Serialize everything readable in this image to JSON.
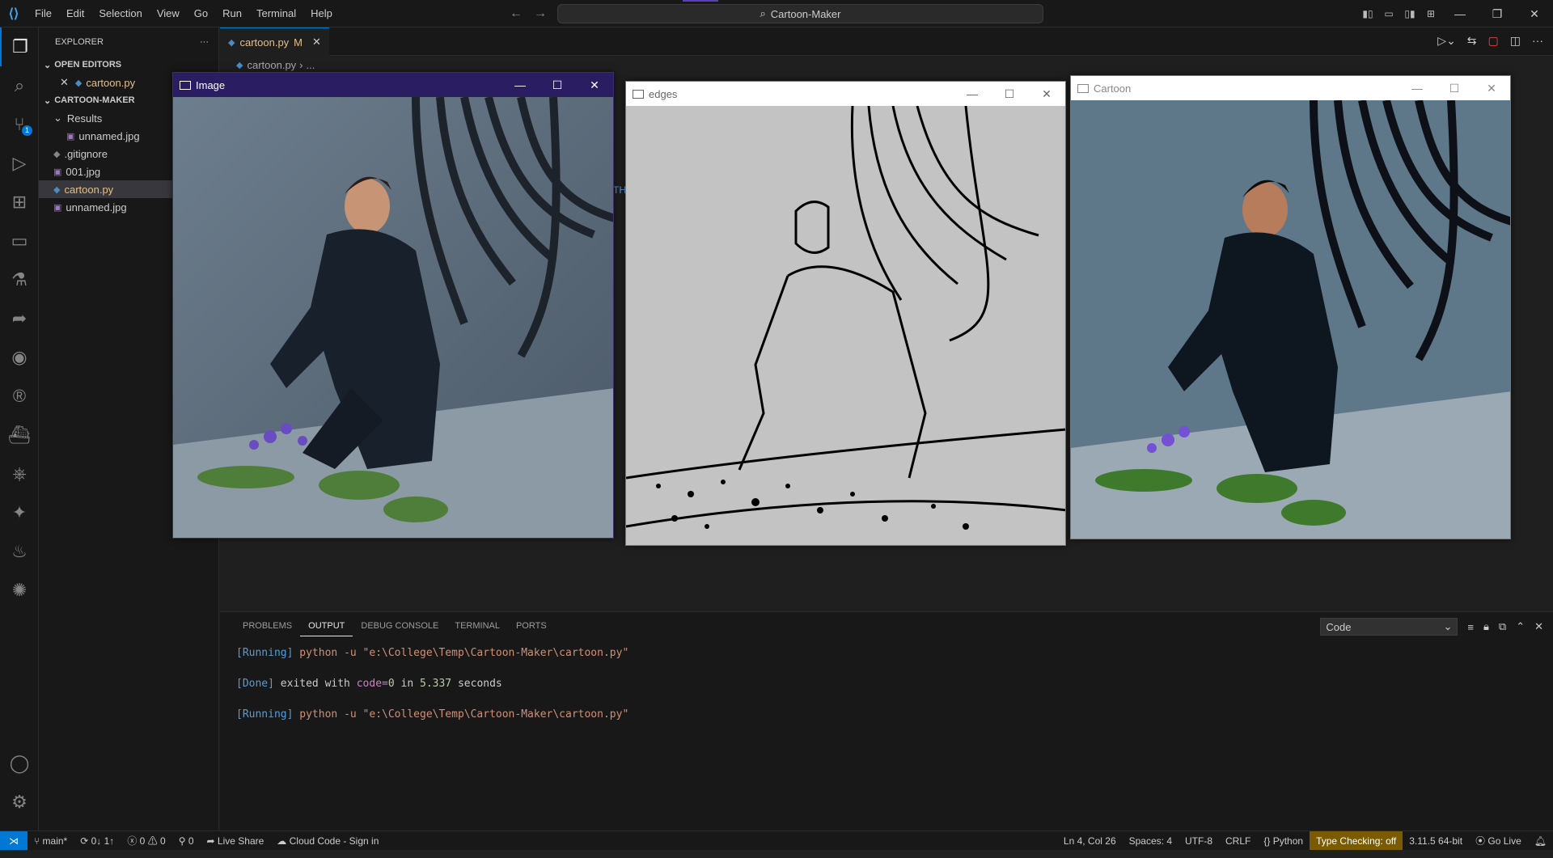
{
  "titlebar": {
    "menu": [
      "File",
      "Edit",
      "Selection",
      "View",
      "Go",
      "Run",
      "Terminal",
      "Help"
    ],
    "search": "Cartoon-Maker"
  },
  "activity": {
    "scm_badge": "1"
  },
  "sidebar": {
    "title": "EXPLORER",
    "more": "···",
    "open_editors_label": "OPEN EDITORS",
    "open_editors": [
      {
        "name": "cartoon.py"
      }
    ],
    "project_label": "CARTOON-MAKER",
    "folder": "Results",
    "folder_files": [
      "unnamed.jpg"
    ],
    "files": [
      ".gitignore",
      "001.jpg",
      "cartoon.py",
      "unnamed.jpg"
    ]
  },
  "editor": {
    "tab": {
      "name": "cartoon.py",
      "status": "M"
    },
    "breadcrumb": [
      "cartoon.py",
      "..."
    ],
    "peek_text": "TH"
  },
  "panel": {
    "tabs": [
      "PROBLEMS",
      "OUTPUT",
      "DEBUG CONSOLE",
      "TERMINAL",
      "PORTS"
    ],
    "active_tab": "OUTPUT",
    "channel": "Code",
    "output": [
      {
        "tag": "[Running]",
        "text": " python -u \"e:\\College\\Temp\\Cartoon-Maker\\cartoon.py\""
      },
      {
        "tag": "[Done]",
        "pre": " exited with ",
        "kw": "code=",
        "num": "0",
        "mid": " in ",
        "secs": "5.337",
        "post": " seconds"
      },
      {
        "tag": "[Running]",
        "text": " python -u \"e:\\College\\Temp\\Cartoon-Maker\\cartoon.py\""
      }
    ]
  },
  "windows": {
    "image": {
      "title": "Image"
    },
    "edges": {
      "title": "edges"
    },
    "cartoon": {
      "title": "Cartoon"
    }
  },
  "status": {
    "branch": "main*",
    "sync": "0↓ 1↑",
    "errors": "0",
    "warnings": "0",
    "ports": "0",
    "live_share": "Live Share",
    "cloud_code": "Cloud Code - Sign in",
    "position": "Ln 4, Col 26",
    "spaces": "Spaces: 4",
    "encoding": "UTF-8",
    "eol": "CRLF",
    "language": "Python",
    "type_checking": "Type Checking: off",
    "interpreter": "3.11.5 64-bit",
    "go_live": "Go Live"
  },
  "colors": {
    "accent": "#0078d4",
    "image_titlebar": "#2b1d62",
    "modified_file": "#e2c08d"
  }
}
